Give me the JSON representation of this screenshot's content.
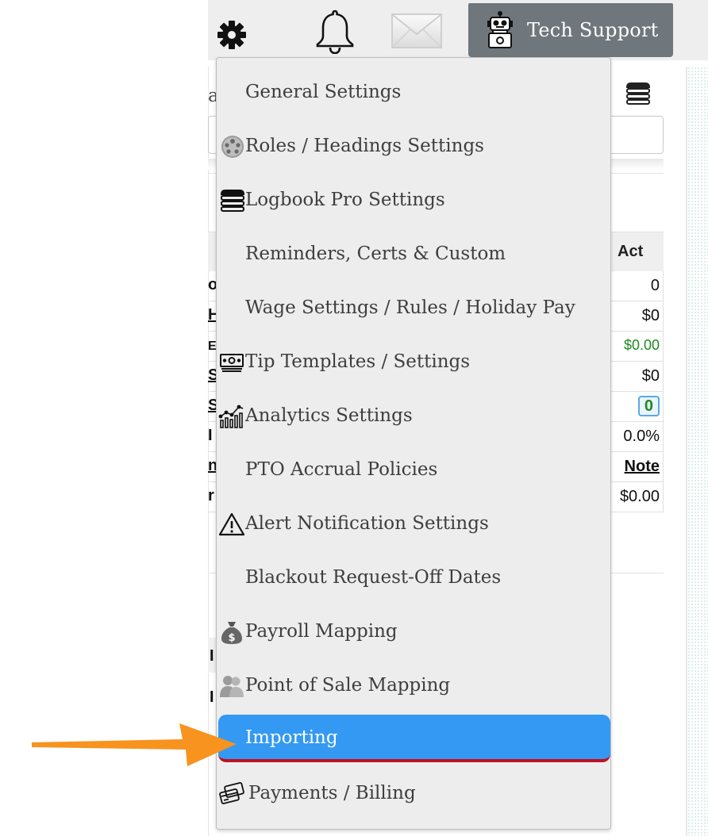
{
  "topbar": {
    "icons": [
      "gear-icon",
      "bell-icon",
      "mail-icon",
      "robot-icon"
    ],
    "tech_support_label": "Tech Support"
  },
  "background": {
    "column_header": "Act",
    "values": [
      "0",
      "$0",
      "$0.00",
      "$0",
      "0",
      "0.0%",
      "Note",
      "$0.00"
    ],
    "accent_green": "#1f8a1f"
  },
  "menu": {
    "items": [
      {
        "label": "General Settings",
        "icon": ""
      },
      {
        "label": "Roles / Headings Settings",
        "icon": "roles-icon"
      },
      {
        "label": "Logbook Pro Settings",
        "icon": "logbook-icon"
      },
      {
        "label": "Reminders, Certs & Custom",
        "icon": ""
      },
      {
        "label": "Wage Settings / Rules / Holiday Pay",
        "icon": ""
      },
      {
        "label": "Tip Templates / Settings",
        "icon": "cash-icon"
      },
      {
        "label": "Analytics Settings",
        "icon": "analytics-icon"
      },
      {
        "label": "PTO Accrual Policies",
        "icon": ""
      },
      {
        "label": "Alert Notification Settings",
        "icon": "warning-icon"
      },
      {
        "label": "Blackout Request-Off Dates",
        "icon": ""
      },
      {
        "label": "Payroll Mapping",
        "icon": "money-bag-icon"
      },
      {
        "label": "Point of Sale Mapping",
        "icon": "users-icon"
      },
      {
        "label": "Importing",
        "icon": "",
        "active": true
      },
      {
        "label": "Payments / Billing",
        "icon": "credit-cards-icon"
      }
    ],
    "active_color": "#3399f3",
    "active_underline_color": "#c0101f"
  },
  "annotation": {
    "arrow_color": "#f7931e"
  }
}
